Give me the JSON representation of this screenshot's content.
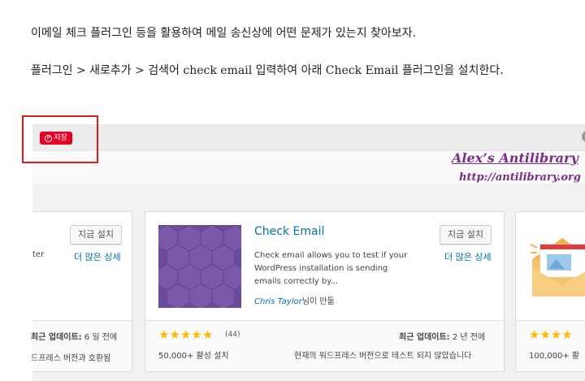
{
  "article": {
    "paragraph1": "이메일 체크 플러그인 등을 활용하여 메일 송신상에 어떤 문제가 있는지 찾아보자.",
    "paragraph2": "플러그인 > 새로추가 > 검색어 check email 입력하여 아래 Check Email 플러그인을 설치한다."
  },
  "pin_button": {
    "label": "저장",
    "icon": "pinterest-icon",
    "color": "#e60023"
  },
  "watermark": {
    "line1": "Alex’s Antilibrary",
    "line2": "http://antilibrary.org"
  },
  "left_card": {
    "install_label": "지금 설치",
    "more_label": "더 많은 상세",
    "desc_fragment": "ter",
    "updated_label": "최근 업데이트:",
    "updated_value": "6 일 전에",
    "compat_text": "드프레스 버전과 호환됨"
  },
  "main_card": {
    "title": "Check Email",
    "description": "Check email allows you to test if your WordPress installation is sending emails correctly by...",
    "author_name": "Chris Taylor",
    "author_suffix": "님이 만듦",
    "install_label": "지금 설치",
    "more_label": "더 많은 상세",
    "rating_stars": 5,
    "rating_count": "(44)",
    "installs": "50,000+ 활성 설치",
    "updated_label": "최근 업데이트:",
    "updated_value": "2 년 전에",
    "compat_text": "현재의 워드프레스 버전으로 테스트 되지 않았습니다",
    "icon_color": "#6b4c9a"
  },
  "right_card": {
    "stars_text": "★★★★",
    "installs": "100,000+ 활"
  },
  "colors": {
    "link": "#0073aa",
    "star": "#ffb900",
    "highlight": "#e01b1b",
    "watermark": "#7a2e86"
  }
}
